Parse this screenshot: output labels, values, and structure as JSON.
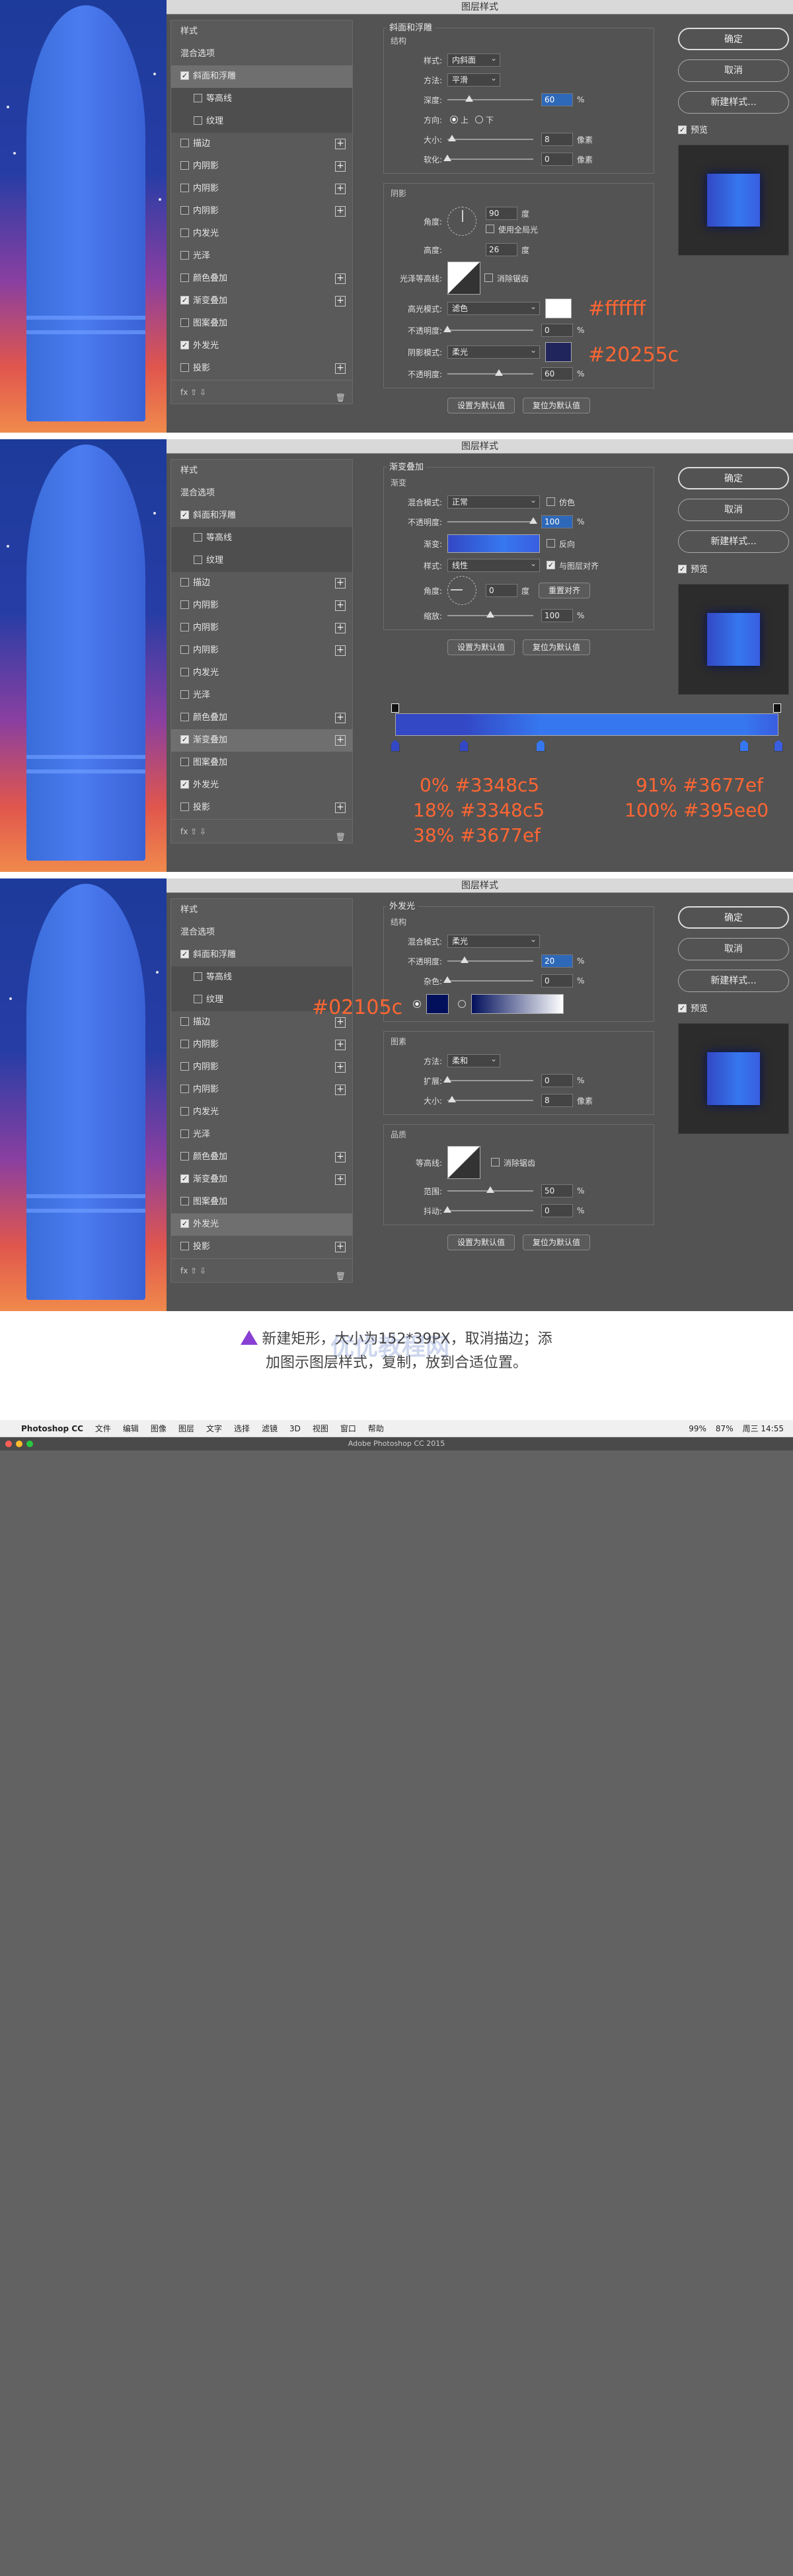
{
  "dialog_title": "图层样式",
  "left_panel": {
    "styles_label": "样式",
    "items": [
      {
        "label": "混合选项",
        "checkbox": false,
        "plus": false,
        "sub": false
      },
      {
        "label": "斜面和浮雕",
        "checkbox": true,
        "checked": true,
        "plus": false,
        "sub": false
      },
      {
        "label": "等高线",
        "checkbox": true,
        "checked": false,
        "plus": false,
        "sub": true
      },
      {
        "label": "纹理",
        "checkbox": true,
        "checked": false,
        "plus": false,
        "sub": true
      },
      {
        "label": "描边",
        "checkbox": true,
        "checked": false,
        "plus": true,
        "sub": false
      },
      {
        "label": "内阴影",
        "checkbox": true,
        "checked": false,
        "plus": true,
        "sub": false
      },
      {
        "label": "内阴影",
        "checkbox": true,
        "checked": false,
        "plus": true,
        "sub": false
      },
      {
        "label": "内阴影",
        "checkbox": true,
        "checked": false,
        "plus": true,
        "sub": false
      },
      {
        "label": "内发光",
        "checkbox": true,
        "checked": false,
        "plus": false,
        "sub": false
      },
      {
        "label": "光泽",
        "checkbox": true,
        "checked": false,
        "plus": false,
        "sub": false
      },
      {
        "label": "颜色叠加",
        "checkbox": true,
        "checked": false,
        "plus": true,
        "sub": false
      },
      {
        "label": "渐变叠加",
        "checkbox": true,
        "checked": true,
        "plus": true,
        "sub": false
      },
      {
        "label": "图案叠加",
        "checkbox": true,
        "checked": false,
        "plus": false,
        "sub": false
      },
      {
        "label": "外发光",
        "checkbox": true,
        "checked": true,
        "plus": false,
        "sub": false
      },
      {
        "label": "投影",
        "checkbox": true,
        "checked": false,
        "plus": true,
        "sub": false
      }
    ],
    "footer_fx": "fx"
  },
  "right_panel": {
    "ok": "确定",
    "cancel": "取消",
    "new_style": "新建样式...",
    "preview": "预览"
  },
  "bevel": {
    "title": "斜面和浮雕",
    "structure": "结构",
    "style_label": "样式:",
    "style_value": "内斜面",
    "technique_label": "方法:",
    "technique_value": "平滑",
    "depth_label": "深度:",
    "depth_value": "60",
    "depth_unit": "%",
    "depth_fraction": 0.6,
    "direction_label": "方向:",
    "dir_up": "上",
    "dir_down": "下",
    "size_label": "大小:",
    "size_value": "8",
    "size_unit": "像素",
    "soften_label": "软化:",
    "soften_value": "0",
    "soften_unit": "像素",
    "shading": "阴影",
    "angle_label": "角度:",
    "angle_value": "90",
    "angle_unit": "度",
    "global_light": "使用全局光",
    "altitude_label": "高度:",
    "altitude_value": "26",
    "altitude_unit": "度",
    "gloss_label": "光泽等高线:",
    "antialias": "消除锯齿",
    "highlight_label": "高光模式:",
    "highlight_value": "滤色",
    "hl_opacity_label": "不透明度:",
    "hl_opacity_value": "0",
    "hl_opacity_unit": "%",
    "shadow_label": "阴影模式:",
    "shadow_value": "柔光",
    "sh_opacity_label": "不透明度:",
    "sh_opacity_value": "60",
    "sh_opacity_unit": "%",
    "make_default": "设置为默认值",
    "reset_default": "复位为默认值",
    "highlight_color": "#ffffff",
    "shadow_color": "#20255c",
    "anno_highlight": "#ffffff",
    "anno_shadow": "#20255c"
  },
  "gradient_overlay": {
    "title": "渐变叠加",
    "subtitle": "渐变",
    "blend_label": "混合模式:",
    "blend_value": "正常",
    "dither": "仿色",
    "opacity_label": "不透明度:",
    "opacity_value": "100",
    "opacity_unit": "%",
    "gradient_label": "渐变:",
    "reverse": "反向",
    "style_label": "样式:",
    "style_value": "线性",
    "align_layer": "与图层对齐",
    "angle_label": "角度:",
    "angle_value": "0",
    "angle_unit": "度",
    "reset_align": "重置对齐",
    "scale_label": "缩放:",
    "scale_value": "100",
    "scale_unit": "%",
    "make_default": "设置为默认值",
    "reset_default": "复位为默认值",
    "stops": [
      {
        "pos": 0,
        "color": "#3348c5",
        "label": "0% #3348c5"
      },
      {
        "pos": 18,
        "color": "#3348c5",
        "label": "18% #3348c5"
      },
      {
        "pos": 38,
        "color": "#3677ef",
        "label": "38% #3677ef"
      },
      {
        "pos": 91,
        "color": "#3677ef",
        "label": "91% #3677ef"
      },
      {
        "pos": 100,
        "color": "#395ee0",
        "label": "100% #395ee0"
      }
    ]
  },
  "outer_glow": {
    "title": "外发光",
    "structure": "结构",
    "blend_label": "混合模式:",
    "blend_value": "柔光",
    "opacity_label": "不透明度:",
    "opacity_value": "20",
    "opacity_unit": "%",
    "noise_label": "杂色:",
    "noise_value": "0",
    "noise_unit": "%",
    "glow_color": "#02105c",
    "anno_color": "#02105c",
    "elements": "图素",
    "method_label": "方法:",
    "method_value": "柔和",
    "spread_label": "扩展:",
    "spread_value": "0",
    "spread_unit": "%",
    "size_label": "大小:",
    "size_value": "8",
    "size_unit": "像素",
    "quality": "品质",
    "contour_label": "等高线:",
    "antialias": "消除锯齿",
    "range_label": "范围:",
    "range_value": "50",
    "range_unit": "%",
    "jitter_label": "抖动:",
    "jitter_value": "0",
    "jitter_unit": "%",
    "make_default": "设置为默认值",
    "reset_default": "复位为默认值"
  },
  "caption": {
    "line1": "新建矩形，大小为152*39PX，取消描边；添",
    "line2": "加图示图层样式，复制，放到合适位置。",
    "watermark": "优优教程网"
  },
  "menubar": {
    "app": "Photoshop CC",
    "items": [
      "文件",
      "编辑",
      "图像",
      "图层",
      "文字",
      "选择",
      "滤镜",
      "3D",
      "视图",
      "窗口",
      "帮助"
    ],
    "status": [
      "99%",
      "87%",
      "周三 14:55"
    ]
  },
  "ps_window_title": "Adobe Photoshop CC 2015"
}
